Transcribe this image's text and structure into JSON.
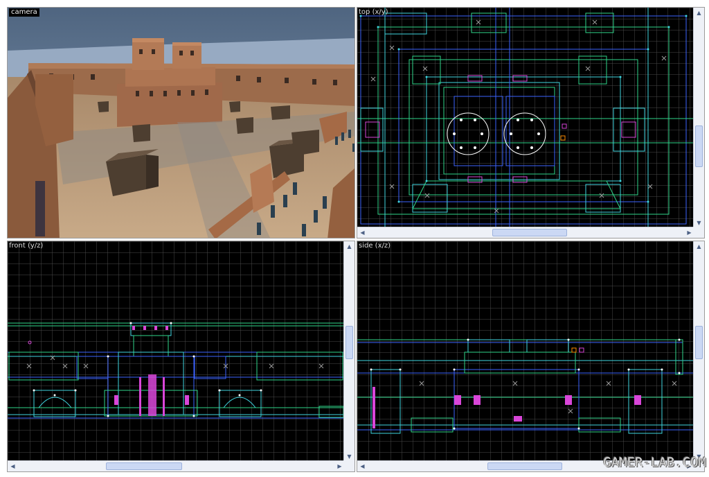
{
  "viewports": {
    "camera": {
      "label": "camera"
    },
    "top": {
      "label": "top (x/y)"
    },
    "front": {
      "label": "front (y/z)"
    },
    "side": {
      "label": "side (x/z)"
    }
  },
  "scroll": {
    "up_arrow": "▲",
    "down_arrow": "▼",
    "left_arrow": "◀",
    "right_arrow": "▶",
    "grip": "|||"
  },
  "watermark": "GAMER-LAB.COM",
  "colors": {
    "grid": "#4d4d4d",
    "brush_green": "#2fd68a",
    "brush_blue": "#3d63ff",
    "brush_cyan": "#3fd6e0",
    "entity_magenta": "#d946d9",
    "vertex_white": "#ffffff",
    "sky": "#5b7392",
    "ground": "#b89a7a",
    "wall": "#9a6a4a"
  }
}
